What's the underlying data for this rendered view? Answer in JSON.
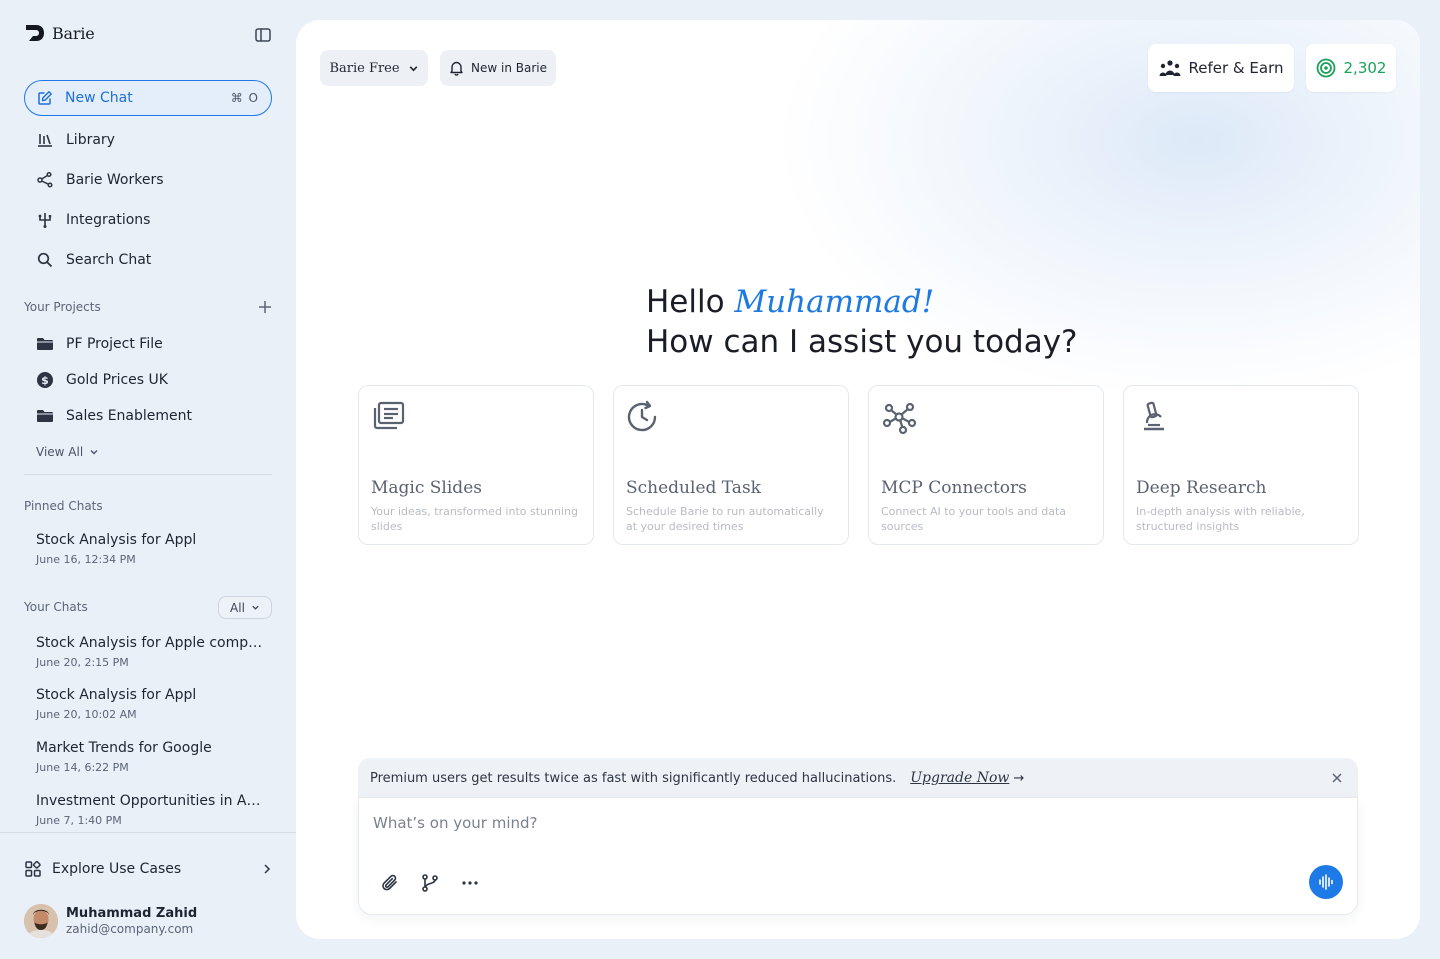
{
  "app": {
    "name": "Barie"
  },
  "sidebar": {
    "new_chat": {
      "label": "New Chat",
      "shortcut": "⌘ O"
    },
    "nav": [
      {
        "label": "Library",
        "icon": "library-icon"
      },
      {
        "label": "Barie Workers",
        "icon": "workers-icon"
      },
      {
        "label": "Integrations",
        "icon": "integrations-icon"
      },
      {
        "label": "Search Chat",
        "icon": "search-icon"
      }
    ],
    "projects": {
      "title": "Your Projects",
      "items": [
        {
          "label": "PF Project File",
          "icon": "folder-icon"
        },
        {
          "label": "Gold Prices UK",
          "icon": "dollar-icon"
        },
        {
          "label": "Sales Enablement",
          "icon": "folder-icon"
        }
      ],
      "view_all": "View All"
    },
    "pinned": {
      "title": "Pinned Chats",
      "items": [
        {
          "title": "Stock Analysis for Appl",
          "date": "June 16, 12:34 PM"
        }
      ]
    },
    "chats": {
      "title": "Your Chats",
      "filter": "All",
      "items": [
        {
          "title": "Stock Analysis for Apple compre...",
          "date": "June 20, 2:15 PM"
        },
        {
          "title": "Stock Analysis for Appl",
          "date": "June 20, 10:02 AM"
        },
        {
          "title": "Market Trends for Google",
          "date": "June 14, 6:22 PM"
        },
        {
          "title": "Investment Opportunities in Am...",
          "date": "June 7, 1:40 PM"
        }
      ]
    },
    "explore": "Explore Use Cases",
    "user": {
      "name": "Muhammad Zahid",
      "email": "zahid@company.com"
    }
  },
  "header": {
    "plan": "Barie Free",
    "new_in": "New in Barie",
    "refer": "Refer & Earn",
    "credits": "2,302"
  },
  "greeting": {
    "hello": "Hello",
    "name": "Muhammad!",
    "question": "How can I assist you today?"
  },
  "cards": [
    {
      "title": "Magic Slides",
      "desc": "Your ideas, transformed into stunning slides",
      "icon": "slides-icon"
    },
    {
      "title": "Scheduled Task",
      "desc": "Schedule Barie to run automatically at your desired times",
      "icon": "schedule-icon"
    },
    {
      "title": "MCP Connectors",
      "desc": "Connect AI to your tools and data sources",
      "icon": "connectors-icon"
    },
    {
      "title": "Deep Research",
      "desc": "In-depth analysis with reliable, structured insights",
      "icon": "microscope-icon"
    }
  ],
  "banner": {
    "message": "Premium users get results twice as fast with significantly reduced hallucinations.",
    "link": "Upgrade Now",
    "arrow": "→"
  },
  "composer": {
    "placeholder": "What’s on your mind?"
  },
  "colors": {
    "accent": "#1e7ae6",
    "credits": "#1aa05a"
  }
}
